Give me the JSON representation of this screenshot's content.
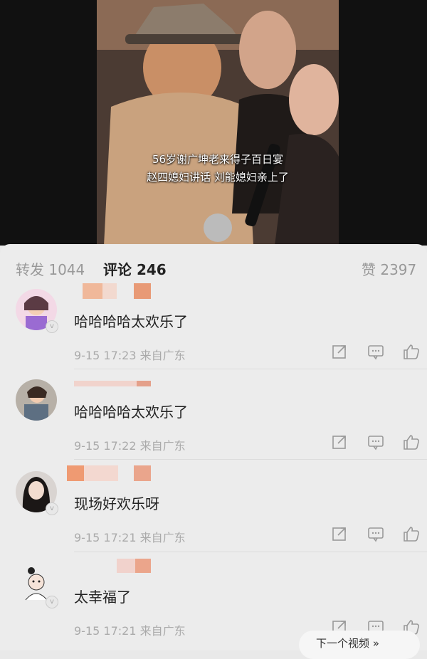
{
  "video": {
    "caption_line1": "56岁谢广坤老来得子百日宴",
    "caption_line2": "赵四媳妇讲话 刘能媳妇亲上了"
  },
  "tabs": {
    "repost": "转发 1044",
    "comments": "评论 246",
    "likes": "赞 2397"
  },
  "comments": [
    {
      "text": "哈哈哈哈太欢乐了",
      "meta": "9-15 17:23 来自广东"
    },
    {
      "text": "哈哈哈哈太欢乐了",
      "meta": "9-15 17:22 来自广东"
    },
    {
      "text": "现场好欢乐呀",
      "meta": "9-15 17:21 来自广东"
    },
    {
      "text": "太幸福了",
      "meta": "9-15 17:21 来自广东"
    }
  ],
  "next_video": "下一个视频 »"
}
